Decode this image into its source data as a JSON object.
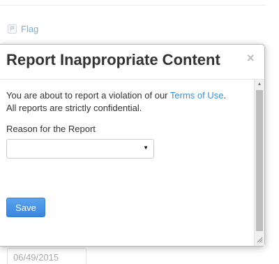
{
  "background": {
    "flag_label": "Flag",
    "date_value": "06/49/2015"
  },
  "modal": {
    "title": "Report Inappropriate Content",
    "close_label": "×",
    "intro_before_link": "You are about to report a violation of our ",
    "terms_link": "Terms of Use",
    "intro_after_link": ".",
    "intro_second_line": "All reports are strictly confidential.",
    "reason_label": "Reason for the Report",
    "reason_selected": "",
    "save_label": "Save"
  },
  "colors": {
    "link": "#3a8fd4",
    "save_button": "#4a97e6",
    "title_text": "#333333"
  },
  "icons": {
    "flag": "flag-icon",
    "close": "close-icon",
    "select_arrow": "chevron-down-icon"
  }
}
